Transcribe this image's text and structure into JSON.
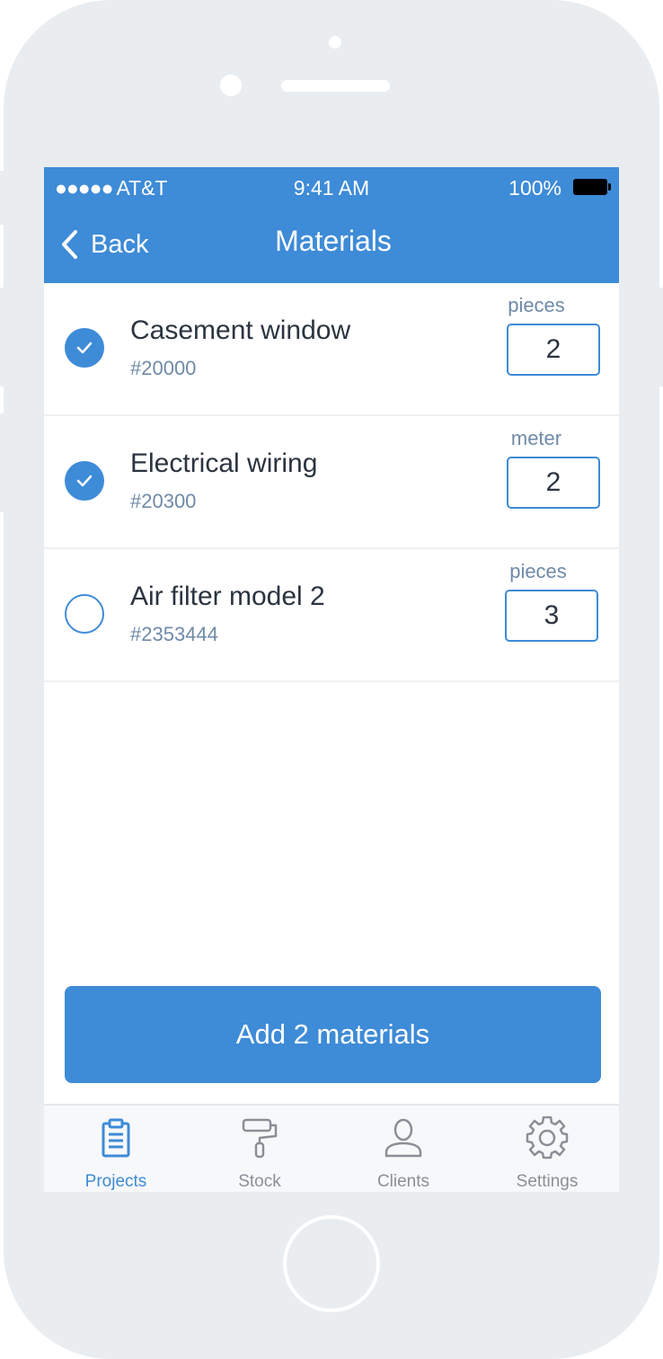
{
  "status_bar": {
    "carrier": "AT&T",
    "signal_dots": "●●●●●",
    "time": "9:41 AM",
    "battery": "100%"
  },
  "nav": {
    "back_label": "Back",
    "title": "Materials"
  },
  "materials": [
    {
      "name": "Casement window",
      "code": "#20000",
      "unit": "pieces",
      "quantity": "2",
      "checked": true
    },
    {
      "name": "Electrical wiring",
      "code": "#20300",
      "unit": "meter",
      "quantity": "2",
      "checked": true
    },
    {
      "name": "Air filter model 2",
      "code": "#2353444",
      "unit": "pieces",
      "quantity": "3",
      "checked": false
    }
  ],
  "add_button": {
    "label": "Add 2 materials"
  },
  "tabs": [
    {
      "label": "Projects",
      "icon": "clipboard-icon",
      "active": true
    },
    {
      "label": "Stock",
      "icon": "paint-roller-icon",
      "active": false
    },
    {
      "label": "Clients",
      "icon": "person-icon",
      "active": false
    },
    {
      "label": "Settings",
      "icon": "gear-icon",
      "active": false
    }
  ],
  "colors": {
    "accent": "#3e8bd7",
    "secondary_text": "#6f8aa9",
    "phone_frame": "#e9edf0"
  }
}
